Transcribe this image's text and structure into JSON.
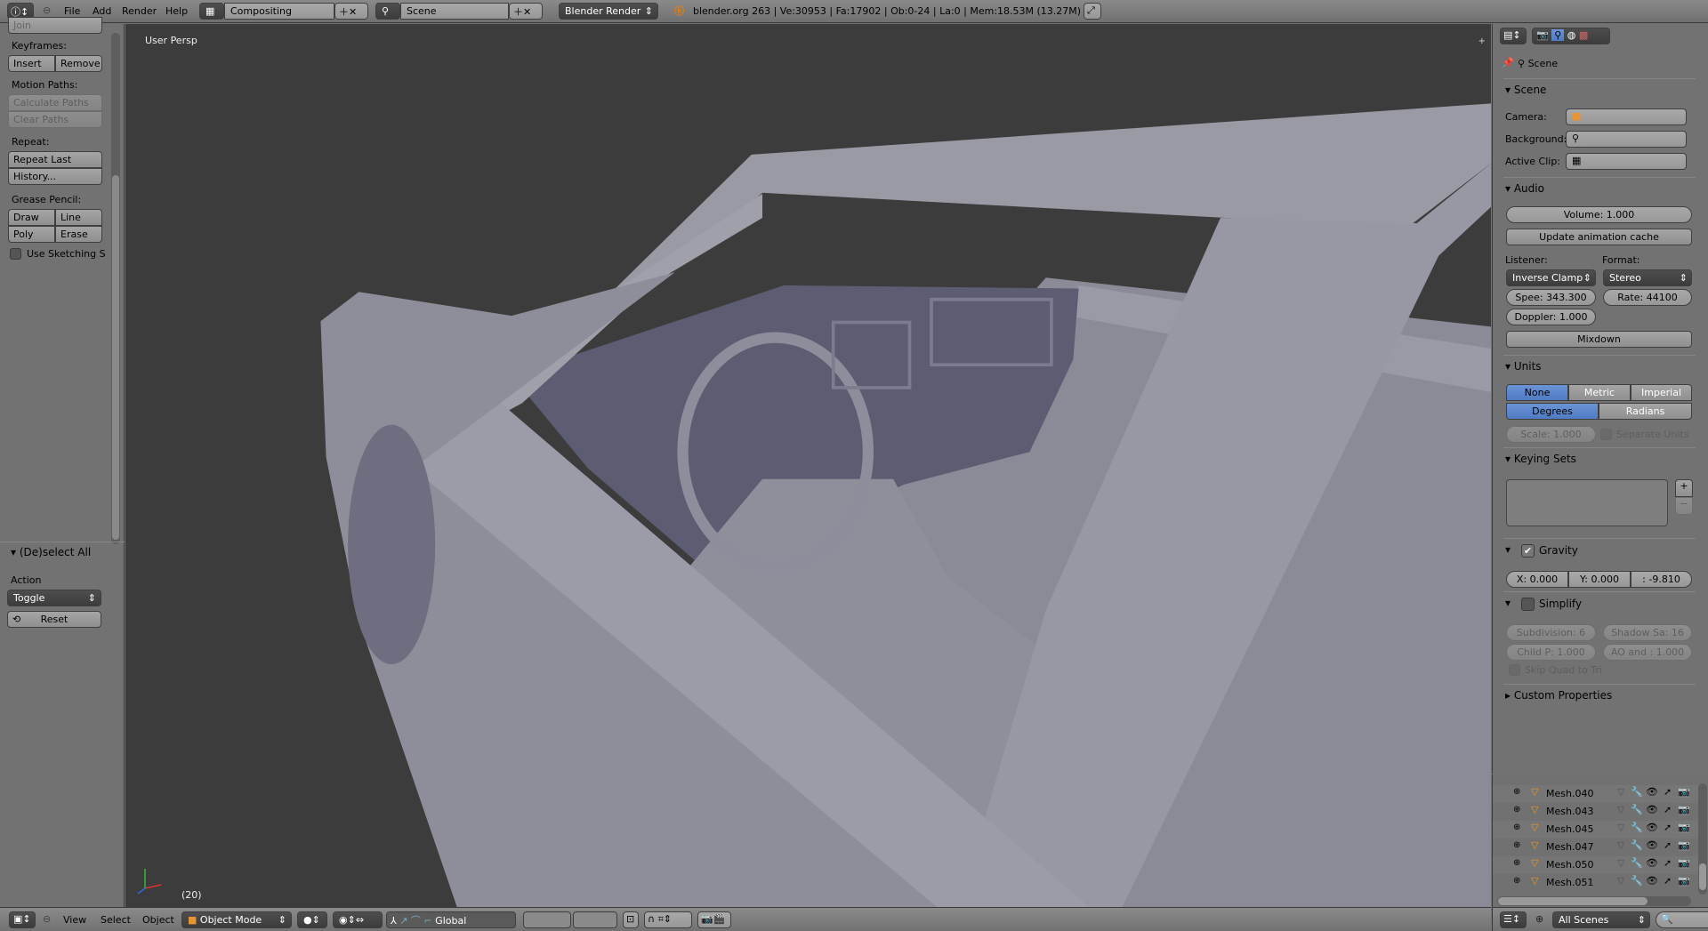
{
  "topbar": {
    "menus": [
      "File",
      "Add",
      "Render",
      "Help"
    ],
    "screen_layout": "Compositing",
    "scene": "Scene",
    "render_engine": "Blender Render",
    "stats": "blender.org 263 | Ve:30953 | Fa:17902 | Ob:0-24 | La:0 | Mem:18.53M (13.27M)"
  },
  "tool_panel": {
    "join_partial": "Join",
    "keyframes_label": "Keyframes:",
    "insert": "Insert",
    "remove": "Remove",
    "motion_paths_label": "Motion Paths:",
    "calculate_paths": "Calculate Paths",
    "clear_paths": "Clear Paths",
    "repeat_label": "Repeat:",
    "repeat_last": "Repeat Last",
    "history": "History...",
    "grease_pencil_label": "Grease Pencil:",
    "draw": "Draw",
    "line": "Line",
    "poly": "Poly",
    "erase": "Erase",
    "use_sketching": "Use Sketching Se",
    "operator_title": "(De)select All",
    "action_label": "Action",
    "action_value": "Toggle",
    "reset": "Reset"
  },
  "viewport": {
    "view_name": "User Persp",
    "frame": "(20)"
  },
  "view_header": {
    "menus": [
      "View",
      "Select",
      "Object"
    ],
    "mode": "Object Mode",
    "orientation": "Global"
  },
  "properties": {
    "context": "Scene",
    "scene_panel": {
      "title": "Scene",
      "camera_label": "Camera:",
      "background_label": "Background:",
      "active_clip_label": "Active Clip:"
    },
    "audio_panel": {
      "title": "Audio",
      "volume": "Volume: 1.000",
      "update_cache": "Update animation cache",
      "listener_label": "Listener:",
      "format_label": "Format:",
      "listener_value": "Inverse Clamp",
      "format_value": "Stereo",
      "speed": "Spee: 343.300",
      "rate": "Rate: 44100",
      "doppler": "Doppler: 1.000",
      "mixdown": "Mixdown"
    },
    "units_panel": {
      "title": "Units",
      "systems": [
        "None",
        "Metric",
        "Imperial"
      ],
      "selected_system": "None",
      "rotation": [
        "Degrees",
        "Radians"
      ],
      "selected_rotation": "Degrees",
      "scale": "Scale: 1.000",
      "separate_units": "Separate Units"
    },
    "keying_sets_panel": {
      "title": "Keying Sets"
    },
    "gravity_panel": {
      "title": "Gravity",
      "enabled": true,
      "x": "X: 0.000",
      "y": "Y: 0.000",
      "z": ": -9.810"
    },
    "simplify_panel": {
      "title": "Simplify",
      "enabled": false,
      "subdivision": "Subdivision: 6",
      "shadow_samples": "Shadow Sa: 16",
      "child_particles": "Child P: 1.000",
      "ao_sss": "AO and : 1.000",
      "skip_quad": "Skip Quad to Tri"
    },
    "custom_properties_panel": {
      "title": "Custom Properties"
    }
  },
  "outliner": {
    "items": [
      "Mesh.040",
      "Mesh.043",
      "Mesh.045",
      "Mesh.047",
      "Mesh.050",
      "Mesh.051"
    ],
    "display_mode": "All Scenes"
  },
  "colors": {
    "accent": "#5680c2",
    "mesh_icon": "#e8952e",
    "viewport_bg": "#3c3c3c"
  }
}
